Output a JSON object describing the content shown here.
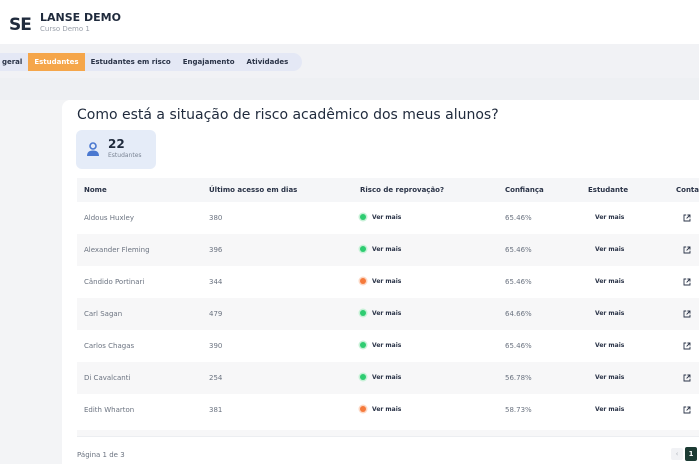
{
  "header": {
    "logo": "SE",
    "title": "LANSE DEMO",
    "subtitle": "Curso Demo 1"
  },
  "tabs": [
    {
      "label": "ão geral",
      "active": false
    },
    {
      "label": "Estudantes",
      "active": true
    },
    {
      "label": "Estudantes em risco",
      "active": false
    },
    {
      "label": "Engajamento",
      "active": false
    },
    {
      "label": "Atividades",
      "active": false
    }
  ],
  "main": {
    "question": "Como está a situação de risco acadêmico dos meus alunos?",
    "stat": {
      "value": "22",
      "label": "Estudantes",
      "icon": "person-icon"
    }
  },
  "table": {
    "columns": [
      "Nome",
      "Último acesso em dias",
      "Risco de reprovação?",
      "Confiança",
      "Estudante",
      "Contat"
    ],
    "rows": [
      {
        "name": "Aldous Huxley",
        "last_access": "380",
        "risk_label": "Ver mais",
        "risk_color": "green",
        "confidence": "65.46%",
        "student": "Ver mais"
      },
      {
        "name": "Alexander Fleming",
        "last_access": "396",
        "risk_label": "Ver mais",
        "risk_color": "green",
        "confidence": "65.46%",
        "student": "Ver mais"
      },
      {
        "name": "Cândido Portinari",
        "last_access": "344",
        "risk_label": "Ver mais",
        "risk_color": "orange",
        "confidence": "65.46%",
        "student": "Ver mais"
      },
      {
        "name": "Carl Sagan",
        "last_access": "479",
        "risk_label": "Ver mais",
        "risk_color": "green",
        "confidence": "64.66%",
        "student": "Ver mais"
      },
      {
        "name": "Carlos Chagas",
        "last_access": "390",
        "risk_label": "Ver mais",
        "risk_color": "green",
        "confidence": "65.46%",
        "student": "Ver mais"
      },
      {
        "name": "Di Cavalcanti",
        "last_access": "254",
        "risk_label": "Ver mais",
        "risk_color": "green",
        "confidence": "56.78%",
        "student": "Ver mais"
      },
      {
        "name": "Edith Wharton",
        "last_access": "381",
        "risk_label": "Ver mais",
        "risk_color": "orange",
        "confidence": "58.73%",
        "student": "Ver mais"
      }
    ],
    "contact_icon": "external-link-icon"
  },
  "pagination": {
    "label": "Página 1 de 3",
    "prev": "‹",
    "current": "1"
  },
  "colors": {
    "accent": "#f5a64a",
    "green": "#2ecc71",
    "orange": "#f57a3c",
    "page_button": "#1c3b33"
  }
}
